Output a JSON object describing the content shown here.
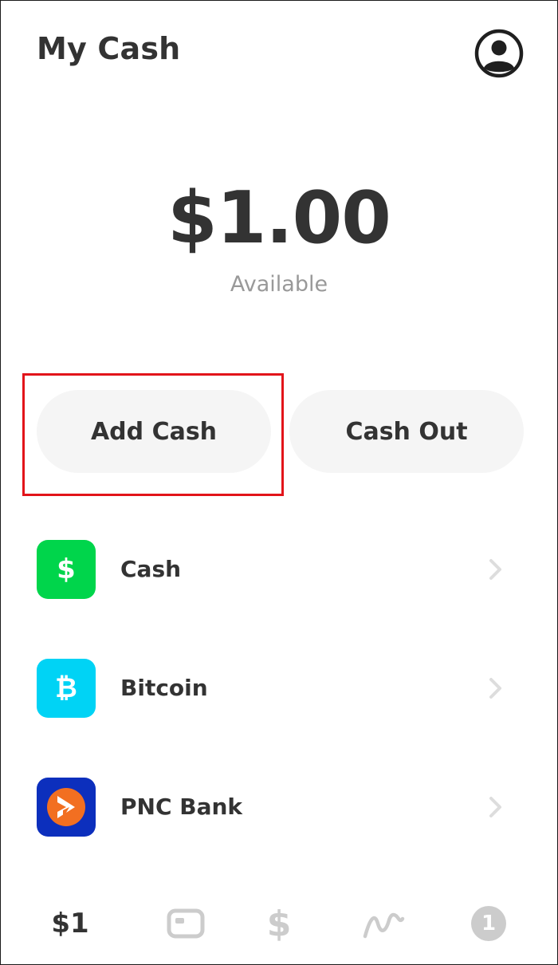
{
  "header": {
    "title": "My Cash",
    "profile_icon": "profile-icon"
  },
  "balance": {
    "amount": "$1.00",
    "label": "Available"
  },
  "actions": {
    "add_cash": "Add Cash",
    "cash_out": "Cash Out"
  },
  "accounts": [
    {
      "label": "Cash",
      "icon": "dollar-icon",
      "glyph": "$",
      "color": "#00d54b"
    },
    {
      "label": "Bitcoin",
      "icon": "bitcoin-icon",
      "glyph": "₿",
      "color": "#00d3f5"
    },
    {
      "label": "PNC Bank",
      "icon": "pnc-bank-logo",
      "color": "#0c2fbd"
    }
  ],
  "tabbar": {
    "balance": "$1",
    "card_icon": "card-icon",
    "dollar": "$",
    "activity_icon": "activity-icon",
    "badge": "1"
  },
  "colors": {
    "highlight": "#e2141a",
    "button_bg": "#f5f5f5",
    "text": "#333333",
    "muted": "#999999"
  }
}
